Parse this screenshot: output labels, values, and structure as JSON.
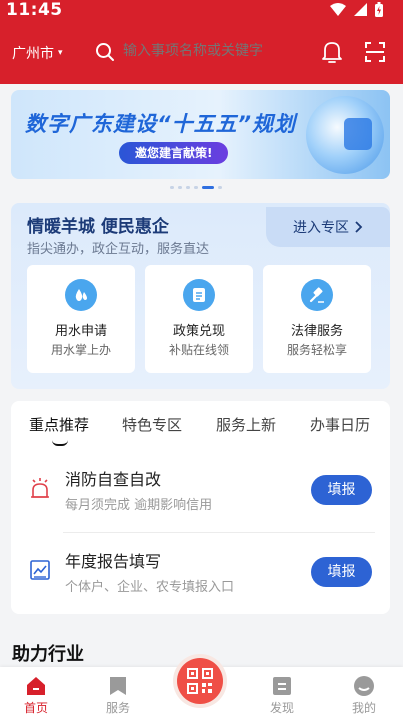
{
  "status_bar": {
    "time": "11:45"
  },
  "topbar": {
    "city": "广州市",
    "search_placeholder": "输入事项名称或关键字"
  },
  "banner": {
    "title": "数字广东建设“十五五”规划",
    "subtitle": "邀您建言献策!"
  },
  "carousel": {
    "count": 6,
    "active_index": 4
  },
  "zone": {
    "title": "情暖羊城 便民惠企",
    "subtitle": "指尖通办，政企互动，服务直达",
    "enter_label": "进入专区",
    "cards": [
      {
        "name": "用水申请",
        "desc": "用水掌上办",
        "icon": "water-drop-icon"
      },
      {
        "name": "政策兑现",
        "desc": "补贴在线领",
        "icon": "document-icon"
      },
      {
        "name": "法律服务",
        "desc": "服务轻松享",
        "icon": "gavel-icon"
      }
    ]
  },
  "tabs": [
    {
      "label": "重点推荐",
      "active": true
    },
    {
      "label": "特色专区",
      "active": false
    },
    {
      "label": "服务上新",
      "active": false
    },
    {
      "label": "办事日历",
      "active": false
    }
  ],
  "items": [
    {
      "title": "消防自查自改",
      "desc": "每月须完成 逾期影响信用",
      "button": "填报",
      "icon": "alarm-icon"
    },
    {
      "title": "年度报告填写",
      "desc": "个体户、企业、农专填报入口",
      "button": "填报",
      "icon": "report-icon"
    }
  ],
  "section_title": "助力行业",
  "nav": [
    {
      "label": "首页",
      "active": true
    },
    {
      "label": "服务",
      "active": false
    },
    {
      "label": "发现",
      "active": false
    },
    {
      "label": "我的",
      "active": false
    }
  ],
  "colors": {
    "brand_red": "#d7202b",
    "accent_blue": "#2d63d4"
  }
}
